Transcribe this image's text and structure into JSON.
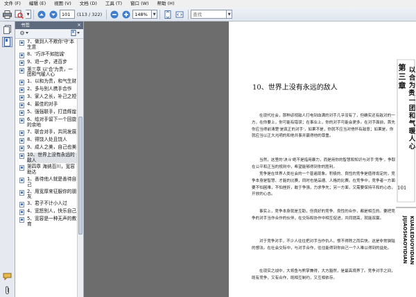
{
  "menu": {
    "items": [
      "文件 (F)",
      "编辑 (E)",
      "视图 (V)",
      "文档 (D)",
      "工具 (T)",
      "窗口 (W)",
      "帮助 (H)"
    ]
  },
  "toolbar": {
    "current_page": "101",
    "page_count": "(113 / 322)",
    "zoom": "148%",
    "search_placeholder": "查找"
  },
  "bookmarks": {
    "title": "书签",
    "items": [
      {
        "label": "7、做到人不欺你'守'本生意",
        "selected": false
      },
      {
        "label": "8、'巧诈不如拙诚'",
        "selected": false
      },
      {
        "label": "9、退一步，进百步",
        "selected": false
      },
      {
        "label": "第三章 以'合'为贵，一团和气暖人心",
        "selected": false
      },
      {
        "label": "1、以和为贵，和气生财",
        "selected": false
      },
      {
        "label": "2、多与别人携手合作",
        "selected": false
      },
      {
        "label": "3、家人之长，补己之短",
        "selected": false
      },
      {
        "label": "4、最佳的对手",
        "selected": false
      },
      {
        "label": "5、强强联手，打造辉煌",
        "selected": false
      },
      {
        "label": "6、给对手留下一个回旋的余地",
        "selected": false
      },
      {
        "label": "7、联合对手，共同发展",
        "selected": false
      },
      {
        "label": "8、得饶人处且饶人",
        "selected": false
      },
      {
        "label": "9、成人之美，自己也美",
        "selected": false
      },
      {
        "label": "10、世界上没有永远的敌人",
        "selected": true
      },
      {
        "label": "第四章 海纳百川，宽容助达",
        "selected": false
      },
      {
        "label": "1、善待他人就是善待自己",
        "selected": false
      },
      {
        "label": "2、用宽厚来征服你的朋友",
        "selected": false
      },
      {
        "label": "3、君子不计小人过",
        "selected": false
      },
      {
        "label": "4、宽怒别人，快乐自己",
        "selected": false
      },
      {
        "label": "5、宽容是一种无声的教育",
        "selected": false
      }
    ]
  },
  "document": {
    "title": "10、世界上没有永远的敌人",
    "paragraphs": [
      "在现代社会，那种谚视敌人打电到血满的对手几乎没有了，但确实还有敌对的一方，在你要上，你可能有错误；在事业上，你的对手可能会更多。在对手面前，首先你应当得前清楚'是真正的对手'，如果不是，你就不应当对他怀有敌意；如果是，你就应当以正大光明的和他共事并赢得他的尊重。",
      "当然，这里的'决斗'绝不是指用暴力，而是用你的智慧和知识与对手'竞争'，争取在公平和正当的规则中，希望能够得到你的胜利。",
      "竞争是在世界人类社会的一个普遍现象。积极的、良性的竞争是值得肯定的，竞争本身是智慧、才能的比赛，同时也是品德、人格的比赛。在竞争中，竞争者一方面要不怕困难，不怕挫折，敢于争强，力求争先；另一方面，又需要保持平和的心态，开放的心态。",
      "事实上，竞争本身就是互助，但良好的竞争、良性的合作，都是相互的。要把竞争的对手当作合作的伙伴，在交际和协作中相互促进，共同提高，就能双赢。",
      "对于竞争对手，不少人往往把对手当作仇人，恨不得除之而后快。这是非常狭隘的想法。在社会交际中，与对手合作，往往能得到你自己一个人难以得到的益处。",
      "在现实之战中，大将鱼与熊掌兼得，大方豁然，是最高境界了。竞争对手之间，既有竞争，又有合作，既相互制约，又互相依存。"
    ],
    "side_chapter": "第三章",
    "side_title": "以合为贵，一团和气暖人心",
    "page_number": "101",
    "side_pinyin": "JIJIAOSHAOYIDIAN KUAILEDUOYIDIAN"
  }
}
